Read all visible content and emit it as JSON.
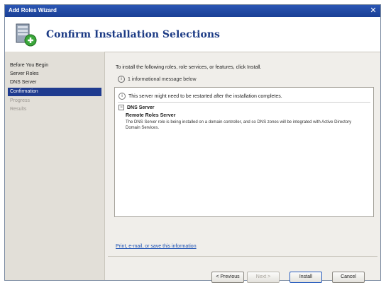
{
  "window": {
    "title": "Add Roles Wizard",
    "close_glyph": "✕"
  },
  "header": {
    "title": "Confirm Installation Selections"
  },
  "sidebar": {
    "items": [
      {
        "label": "Before You Begin",
        "state": "done"
      },
      {
        "label": "Server Roles",
        "state": "done"
      },
      {
        "label": "DNS Server",
        "state": "done"
      },
      {
        "label": "Confirmation",
        "state": "active"
      },
      {
        "label": "Progress",
        "state": "disabled"
      },
      {
        "label": "Results",
        "state": "disabled"
      }
    ]
  },
  "content": {
    "intro": "To install the following roles, role services, or features, click Install.",
    "info_message": "1 informational message below",
    "listbox": {
      "notice": "This server might need to be restarted after the installation completes.",
      "role_title": "DNS Server",
      "feature_name": "Remote Roles Server",
      "feature_desc": "The DNS Server role is being installed on a domain controller, and so DNS zones will be integrated with Active Directory Domain Services."
    },
    "more_link": "Print, e-mail, or save this information"
  },
  "buttons": {
    "previous": "< Previous",
    "next": "Next >",
    "install": "Install",
    "cancel": "Cancel"
  },
  "colors": {
    "accent": "#1f3b8f",
    "titlebar": "#2b56b4",
    "heading": "#1b3a84"
  }
}
